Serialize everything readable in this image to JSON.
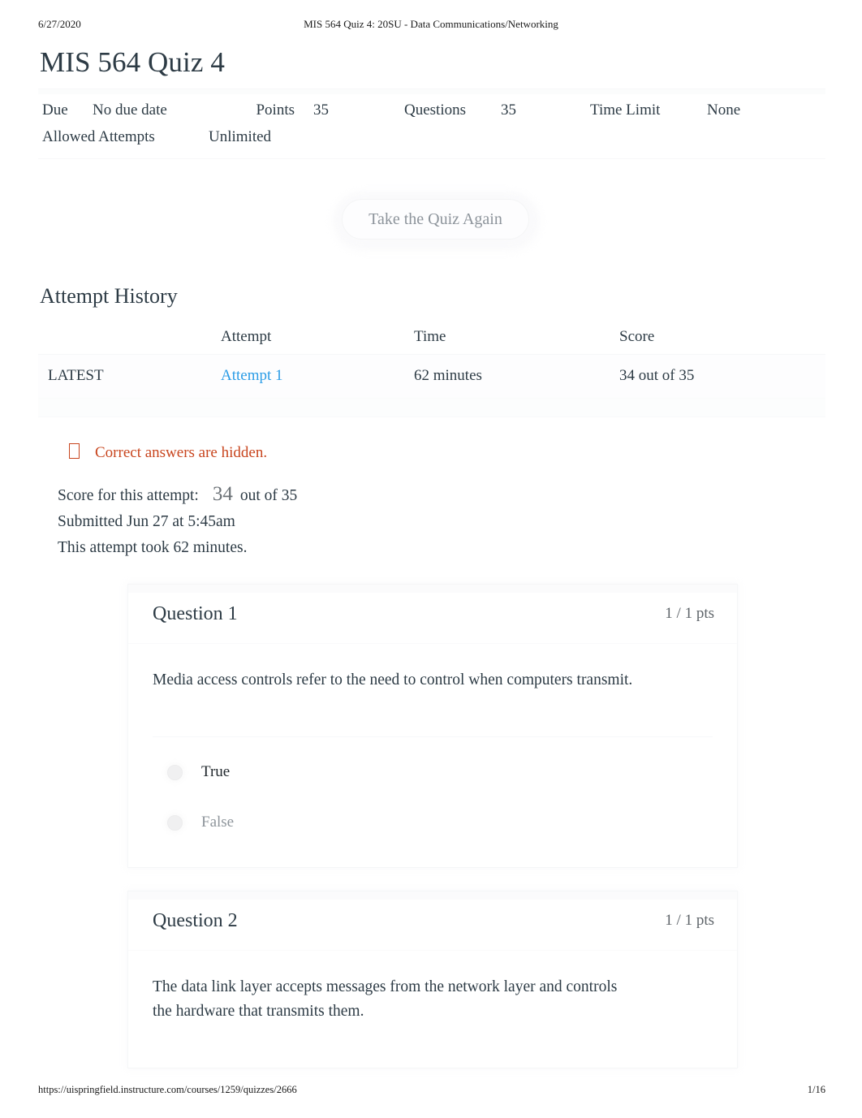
{
  "print_header": {
    "date": "6/27/2020",
    "title": "MIS 564 Quiz 4: 20SU - Data Communications/Networking"
  },
  "print_footer": {
    "url": "https://uispringfield.instructure.com/courses/1259/quizzes/2666",
    "page": "1/16"
  },
  "quiz": {
    "title": "MIS 564 Quiz 4",
    "meta": {
      "due_label": "Due",
      "due_value": "No due date",
      "points_label": "Points",
      "points_value": "35",
      "questions_label": "Questions",
      "questions_value": "35",
      "time_limit_label": "Time Limit",
      "time_limit_value": "None",
      "allowed_attempts_label": "Allowed Attempts",
      "allowed_attempts_value": "Unlimited"
    },
    "retake_button": "Take the Quiz Again"
  },
  "attempt_history": {
    "heading": "Attempt History",
    "columns": [
      "",
      "Attempt",
      "Time",
      "Score"
    ],
    "rows": [
      {
        "kept": "LATEST",
        "attempt": "Attempt 1",
        "time": "62 minutes",
        "score": "34 out of 35"
      }
    ]
  },
  "notice": {
    "icon": "warning-box-icon",
    "text": "Correct answers are hidden."
  },
  "attempt_summary": {
    "score_label": "Score for this attempt:",
    "score_value": "34",
    "score_out_of": "out of 35",
    "submitted": "Submitted Jun 27 at 5:45am",
    "duration": "This attempt took 62 minutes."
  },
  "questions": [
    {
      "name": "Question 1",
      "points": "1 / 1 pts",
      "text": "Media access controls refer to the need to control when computers transmit.",
      "answers": [
        {
          "label": "True",
          "selected": true
        },
        {
          "label": "False",
          "selected": false
        }
      ]
    },
    {
      "name": "Question 2",
      "points": "1 / 1 pts",
      "text": "The data link layer accepts messages from the network layer and controls the hardware that transmits them.",
      "answers": []
    }
  ],
  "colors": {
    "link": "#2b9ce6",
    "notice": "#c8451e",
    "text": "#2d3b45",
    "muted": "#8e959b"
  }
}
